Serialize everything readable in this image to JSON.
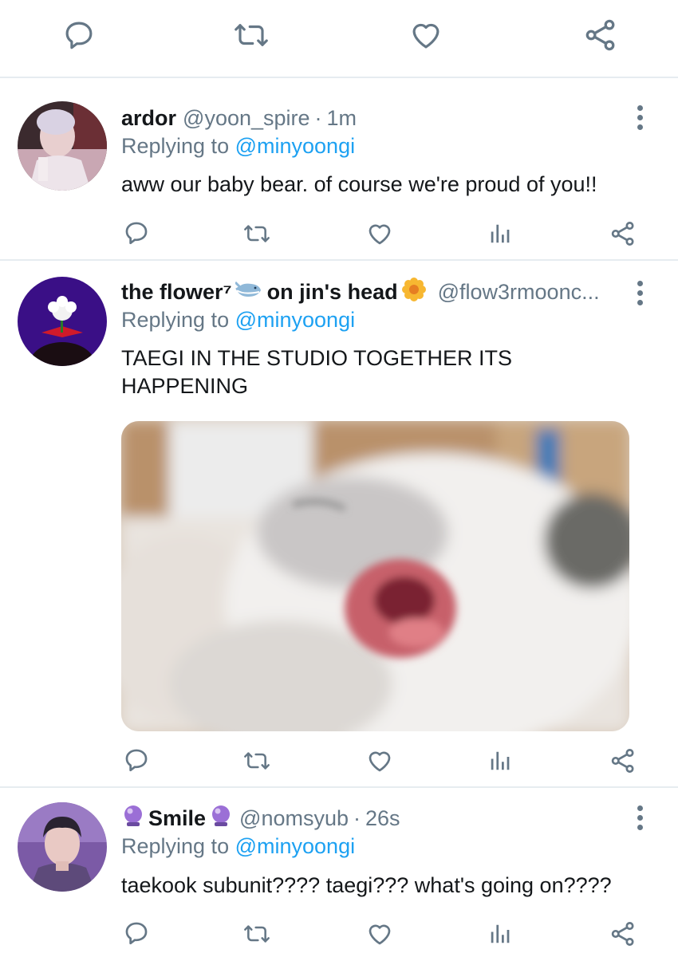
{
  "top_actions": {
    "icons": [
      "reply-icon",
      "retweet-icon",
      "like-icon",
      "share-icon"
    ]
  },
  "tweets": [
    {
      "name": "ardor",
      "handle": "@yoon_spire",
      "separator": "·",
      "time": "1m",
      "replying_prefix": "Replying to",
      "replying_to": "@minyoongi",
      "text": "aww our baby bear. of course we're proud of you!!"
    },
    {
      "name_part1": "the flower⁷",
      "name_part2": "on jin's head",
      "handle": "@flow3rmoonc...",
      "replying_prefix": "Replying to",
      "replying_to": "@minyoongi",
      "text_line1": "TAEGI IN THE STUDIO TOGETHER ITS",
      "text_line2": "HAPPENING",
      "media": "cat-yawning-photo"
    },
    {
      "name": "Smile",
      "handle": "@nomsyub",
      "separator": "·",
      "time": "26s",
      "replying_prefix": "Replying to",
      "replying_to": "@minyoongi",
      "text": "taekook subunit???? taegi??? what's going on????"
    }
  ],
  "colors": {
    "link": "#1da1f2",
    "secondary_text": "#657786",
    "primary_text": "#14171a",
    "divider": "#e6ecf0"
  }
}
